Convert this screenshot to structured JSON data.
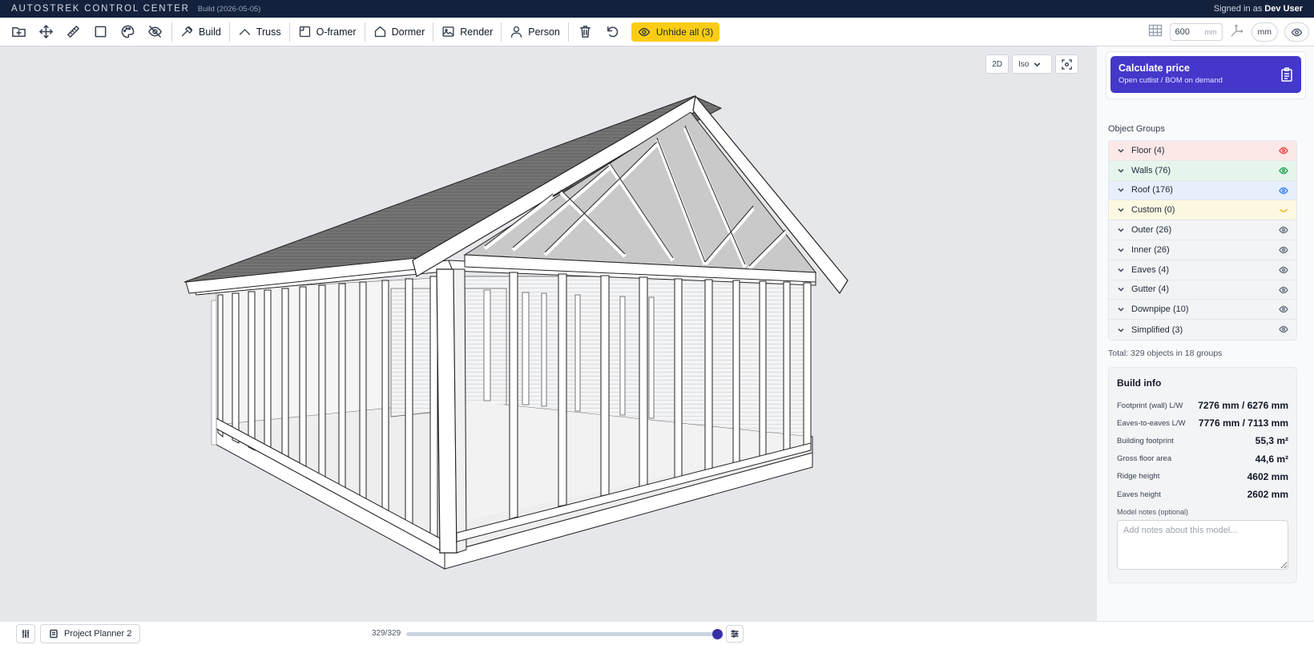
{
  "titlebar": {
    "app_title": "AUTOSTREK CONTROL CENTER",
    "build_tag": "Build (2026-05-05)",
    "signed_in_prefix": "Signed in as",
    "user_name": "Dev User"
  },
  "toolbar": {
    "tools": [
      {
        "name": "Build",
        "icon": "hammer-icon"
      },
      {
        "name": "Truss",
        "icon": "truss-icon"
      },
      {
        "name": "O-framer",
        "icon": "frame-icon"
      },
      {
        "name": "Dormer",
        "icon": "house-icon"
      },
      {
        "name": "Render",
        "icon": "image-icon"
      },
      {
        "name": "Person",
        "icon": "person-icon"
      }
    ],
    "build_label": "Build",
    "truss_label": "Truss",
    "oframer_label": "O-framer",
    "dormer_label": "Dormer",
    "render_label": "Render",
    "person_label": "Person",
    "unhide_label": "Unhide all (3)",
    "unhide_color": "#facc15",
    "size_value": "600",
    "size_unit": "mm",
    "units_label": "mm"
  },
  "viewport": {
    "view_2d_label": "2D",
    "view_mode": "Iso"
  },
  "sidepanel": {
    "calculate": {
      "title": "Calculate price",
      "subtitle": "Open cutlist / BOM on demand",
      "color": "#4338ca"
    },
    "object_groups_title": "Object Groups",
    "groups": [
      {
        "label": "Floor (4)",
        "color": "#fde8e8",
        "eye_color": "#ef4444"
      },
      {
        "label": "Walls (76)",
        "color": "#e6f6ec",
        "eye_color": "#22a35a"
      },
      {
        "label": "Roof (176)",
        "color": "#e6effb",
        "eye_color": "#3b82f6"
      },
      {
        "label": "Custom (0)",
        "color": "#fdf8e1",
        "eye_color": "#eab308"
      },
      {
        "label": "Outer (26)",
        "color": "#f3f4f6",
        "eye_color": "#6b7280"
      },
      {
        "label": "Inner (26)",
        "color": "#f3f4f6",
        "eye_color": "#6b7280"
      },
      {
        "label": "Eaves (4)",
        "color": "#f3f4f6",
        "eye_color": "#6b7280"
      },
      {
        "label": "Gutter (4)",
        "color": "#f3f4f6",
        "eye_color": "#6b7280"
      },
      {
        "label": "Downpipe (10)",
        "color": "#f3f4f6",
        "eye_color": "#6b7280"
      },
      {
        "label": "Simplified (3)",
        "color": "#f3f4f6",
        "eye_color": "#6b7280"
      }
    ],
    "total": "Total: 329 objects in 18 groups",
    "build_info": {
      "title": "Build info",
      "rows": [
        {
          "key": "Footprint (wall) L/W",
          "value": "7276 mm / 6276 mm"
        },
        {
          "key": "Eaves-to-eaves L/W",
          "value": "7776 mm / 7113 mm"
        },
        {
          "key": "Building footprint",
          "value": "55,3 m²"
        },
        {
          "key": "Gross floor area",
          "value": "44,6 m²"
        },
        {
          "key": "Ridge height",
          "value": "4602 mm"
        },
        {
          "key": "Eaves height",
          "value": "2602 mm"
        }
      ],
      "notes_label": "Model notes (optional)",
      "notes_placeholder": "Add notes about this model..."
    }
  },
  "bottombar": {
    "project_name": "Project Planner 2",
    "object_count": "329/329",
    "slider_fraction": 1.0
  }
}
